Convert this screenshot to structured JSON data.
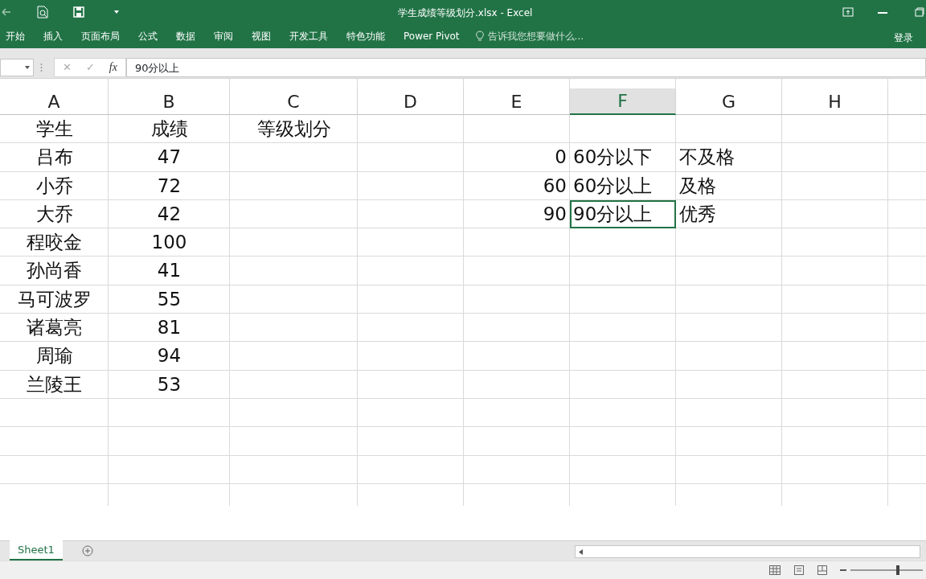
{
  "window": {
    "title": "学生成绩等级划分.xlsx - Excel"
  },
  "ribbon": {
    "tabs": [
      {
        "label": "开始",
        "selected": false
      },
      {
        "label": "插入",
        "selected": false
      },
      {
        "label": "页面布局",
        "selected": false
      },
      {
        "label": "公式",
        "selected": false
      },
      {
        "label": "数据",
        "selected": false
      },
      {
        "label": "审阅",
        "selected": false
      },
      {
        "label": "视图",
        "selected": false
      },
      {
        "label": "开发工具",
        "selected": false
      },
      {
        "label": "特色功能",
        "selected": false
      },
      {
        "label": "Power Pivot",
        "selected": false
      }
    ],
    "tell_me": {
      "placeholder": "告诉我您想要做什么..."
    },
    "sign_in": "登录"
  },
  "formula_bar": {
    "cancel": "✕",
    "enter": "✓",
    "fx": "fx",
    "value": "90分以上"
  },
  "columns": [
    {
      "label": "A",
      "selected": false
    },
    {
      "label": "B",
      "selected": false
    },
    {
      "label": "C",
      "selected": false
    },
    {
      "label": "D",
      "selected": false
    },
    {
      "label": "E",
      "selected": false
    },
    {
      "label": "F",
      "selected": true
    },
    {
      "label": "G",
      "selected": false
    },
    {
      "label": "H",
      "selected": false
    }
  ],
  "rows": [
    [
      {
        "text": "学生",
        "kind": "center",
        "selected": false
      },
      {
        "text": "成绩",
        "kind": "center",
        "selected": false
      },
      {
        "text": "等级划分",
        "kind": "center",
        "selected": false
      },
      null,
      null,
      null,
      null,
      null
    ],
    [
      {
        "text": "吕布",
        "kind": "center",
        "selected": false
      },
      {
        "text": "47",
        "kind": "center",
        "selected": false
      },
      null,
      null,
      {
        "text": "0",
        "kind": "number",
        "selected": false
      },
      {
        "text": "60分以下",
        "kind": "left",
        "selected": false
      },
      {
        "text": "不及格",
        "kind": "left",
        "selected": false
      },
      null
    ],
    [
      {
        "text": "小乔",
        "kind": "center",
        "selected": false
      },
      {
        "text": "72",
        "kind": "center",
        "selected": false
      },
      null,
      null,
      {
        "text": "60",
        "kind": "number",
        "selected": false
      },
      {
        "text": "60分以上",
        "kind": "left",
        "selected": false
      },
      {
        "text": "及格",
        "kind": "left",
        "selected": false
      },
      null
    ],
    [
      {
        "text": "大乔",
        "kind": "center",
        "selected": false
      },
      {
        "text": "42",
        "kind": "center",
        "selected": false
      },
      null,
      null,
      {
        "text": "90",
        "kind": "number",
        "selected": false
      },
      {
        "text": "90分以上",
        "kind": "left",
        "selected": true
      },
      {
        "text": "优秀",
        "kind": "left",
        "selected": false
      },
      null
    ],
    [
      {
        "text": "程咬金",
        "kind": "center",
        "selected": false
      },
      {
        "text": "100",
        "kind": "center",
        "selected": false
      },
      null,
      null,
      null,
      null,
      null,
      null
    ],
    [
      {
        "text": "孙尚香",
        "kind": "center",
        "selected": false
      },
      {
        "text": "41",
        "kind": "center",
        "selected": false
      },
      null,
      null,
      null,
      null,
      null,
      null
    ],
    [
      {
        "text": "马可波罗",
        "kind": "center",
        "selected": false
      },
      {
        "text": "55",
        "kind": "center",
        "selected": false
      },
      null,
      null,
      null,
      null,
      null,
      null
    ],
    [
      {
        "text": "诸葛亮",
        "kind": "center",
        "selected": false
      },
      {
        "text": "81",
        "kind": "center",
        "selected": false
      },
      null,
      null,
      null,
      null,
      null,
      null
    ],
    [
      {
        "text": "周瑜",
        "kind": "center",
        "selected": false
      },
      {
        "text": "94",
        "kind": "center",
        "selected": false
      },
      null,
      null,
      null,
      null,
      null,
      null
    ],
    [
      {
        "text": "兰陵王",
        "kind": "center",
        "selected": false
      },
      {
        "text": "53",
        "kind": "center",
        "selected": false
      },
      null,
      null,
      null,
      null,
      null,
      null
    ]
  ],
  "sheets": [
    {
      "label": "Sheet1",
      "selected": true
    }
  ],
  "status_bar": {
    "zoom_slider": {
      "level": 0.66
    }
  }
}
